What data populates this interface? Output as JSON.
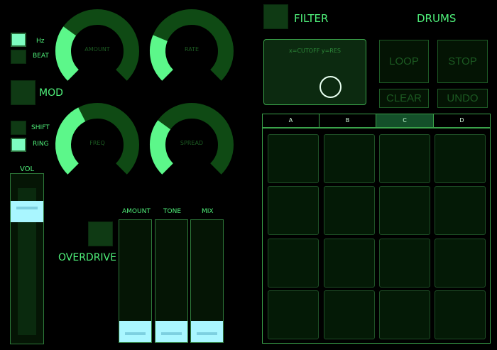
{
  "mod_section": {
    "hz_label": "Hz",
    "beat_label": "BEAT",
    "mod_label": "MOD",
    "shift_label": "SHIFT",
    "ring_label": "RING",
    "hz_on": true,
    "beat_on": false,
    "mod_on": false,
    "shift_on": false,
    "ring_on": true
  },
  "knobs": [
    {
      "label": "AMOUNT",
      "value": 0.3
    },
    {
      "label": "RATE",
      "value": 0.25
    },
    {
      "label": "FREQ",
      "value": 0.4
    },
    {
      "label": "SPREAD",
      "value": 0.3
    }
  ],
  "volume": {
    "label": "VOL",
    "value": 0.82
  },
  "overdrive": {
    "label": "OVERDRIVE",
    "on": false
  },
  "overdrive_sliders": [
    {
      "label": "AMOUNT",
      "value": 0.0
    },
    {
      "label": "TONE",
      "value": 0.0
    },
    {
      "label": "MIX",
      "value": 0.0
    }
  ],
  "filter": {
    "label": "FILTER",
    "on": false,
    "xy_hint": "x=CUTOFF  y=RES"
  },
  "drums": {
    "label": "DRUMS",
    "loop_label": "LOOP",
    "stop_label": "STOP",
    "clear_label": "CLEAR",
    "undo_label": "UNDO",
    "tabs": [
      "A",
      "B",
      "C",
      "D"
    ],
    "active_tab": "C"
  },
  "colors": {
    "accent": "#4ff07a",
    "knob_track": "#0f4a14",
    "knob_fill": "#5cf78a",
    "highlight": "#a9f6ff"
  }
}
